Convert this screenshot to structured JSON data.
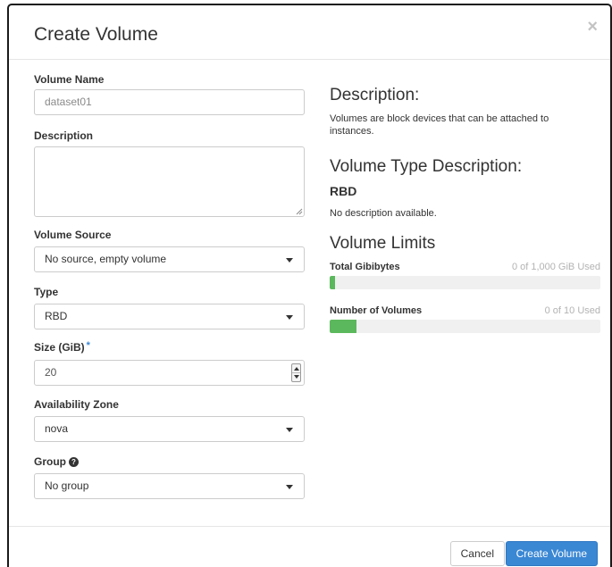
{
  "dialog": {
    "title": "Create Volume",
    "close_glyph": "×"
  },
  "form": {
    "volume_name": {
      "label": "Volume Name",
      "value": "dataset01"
    },
    "description": {
      "label": "Description",
      "value": ""
    },
    "volume_source": {
      "label": "Volume Source",
      "selected": "No source, empty volume"
    },
    "type": {
      "label": "Type",
      "selected": "RBD"
    },
    "size": {
      "label": "Size (GiB)",
      "required_mark": "*",
      "value": "20"
    },
    "availability_zone": {
      "label": "Availability Zone",
      "selected": "nova"
    },
    "group": {
      "label": "Group",
      "help_glyph": "?",
      "selected": "No group"
    }
  },
  "info": {
    "description_heading": "Description:",
    "description_text_line1": "Volumes are block devices that can be attached to",
    "description_text_line2": "instances.",
    "type_heading": "Volume Type Description:",
    "type_name": "RBD",
    "type_desc": "No description available.",
    "limits_heading": "Volume Limits",
    "limits": [
      {
        "label": "Total Gibibytes",
        "used_text": "0 of 1,000 GiB Used",
        "fill_fraction": 0.02
      },
      {
        "label": "Number of Volumes",
        "used_text": "0 of 10 Used",
        "fill_fraction": 0.1
      }
    ]
  },
  "footer": {
    "cancel_label": "Cancel",
    "submit_label": "Create Volume"
  },
  "colors": {
    "primary": "#3a87d4",
    "progress_fill": "#5cb85c"
  },
  "icons": [
    "close-icon",
    "chevron-down-icon",
    "help-icon",
    "spinner-icon",
    "resize-grip-icon"
  ]
}
